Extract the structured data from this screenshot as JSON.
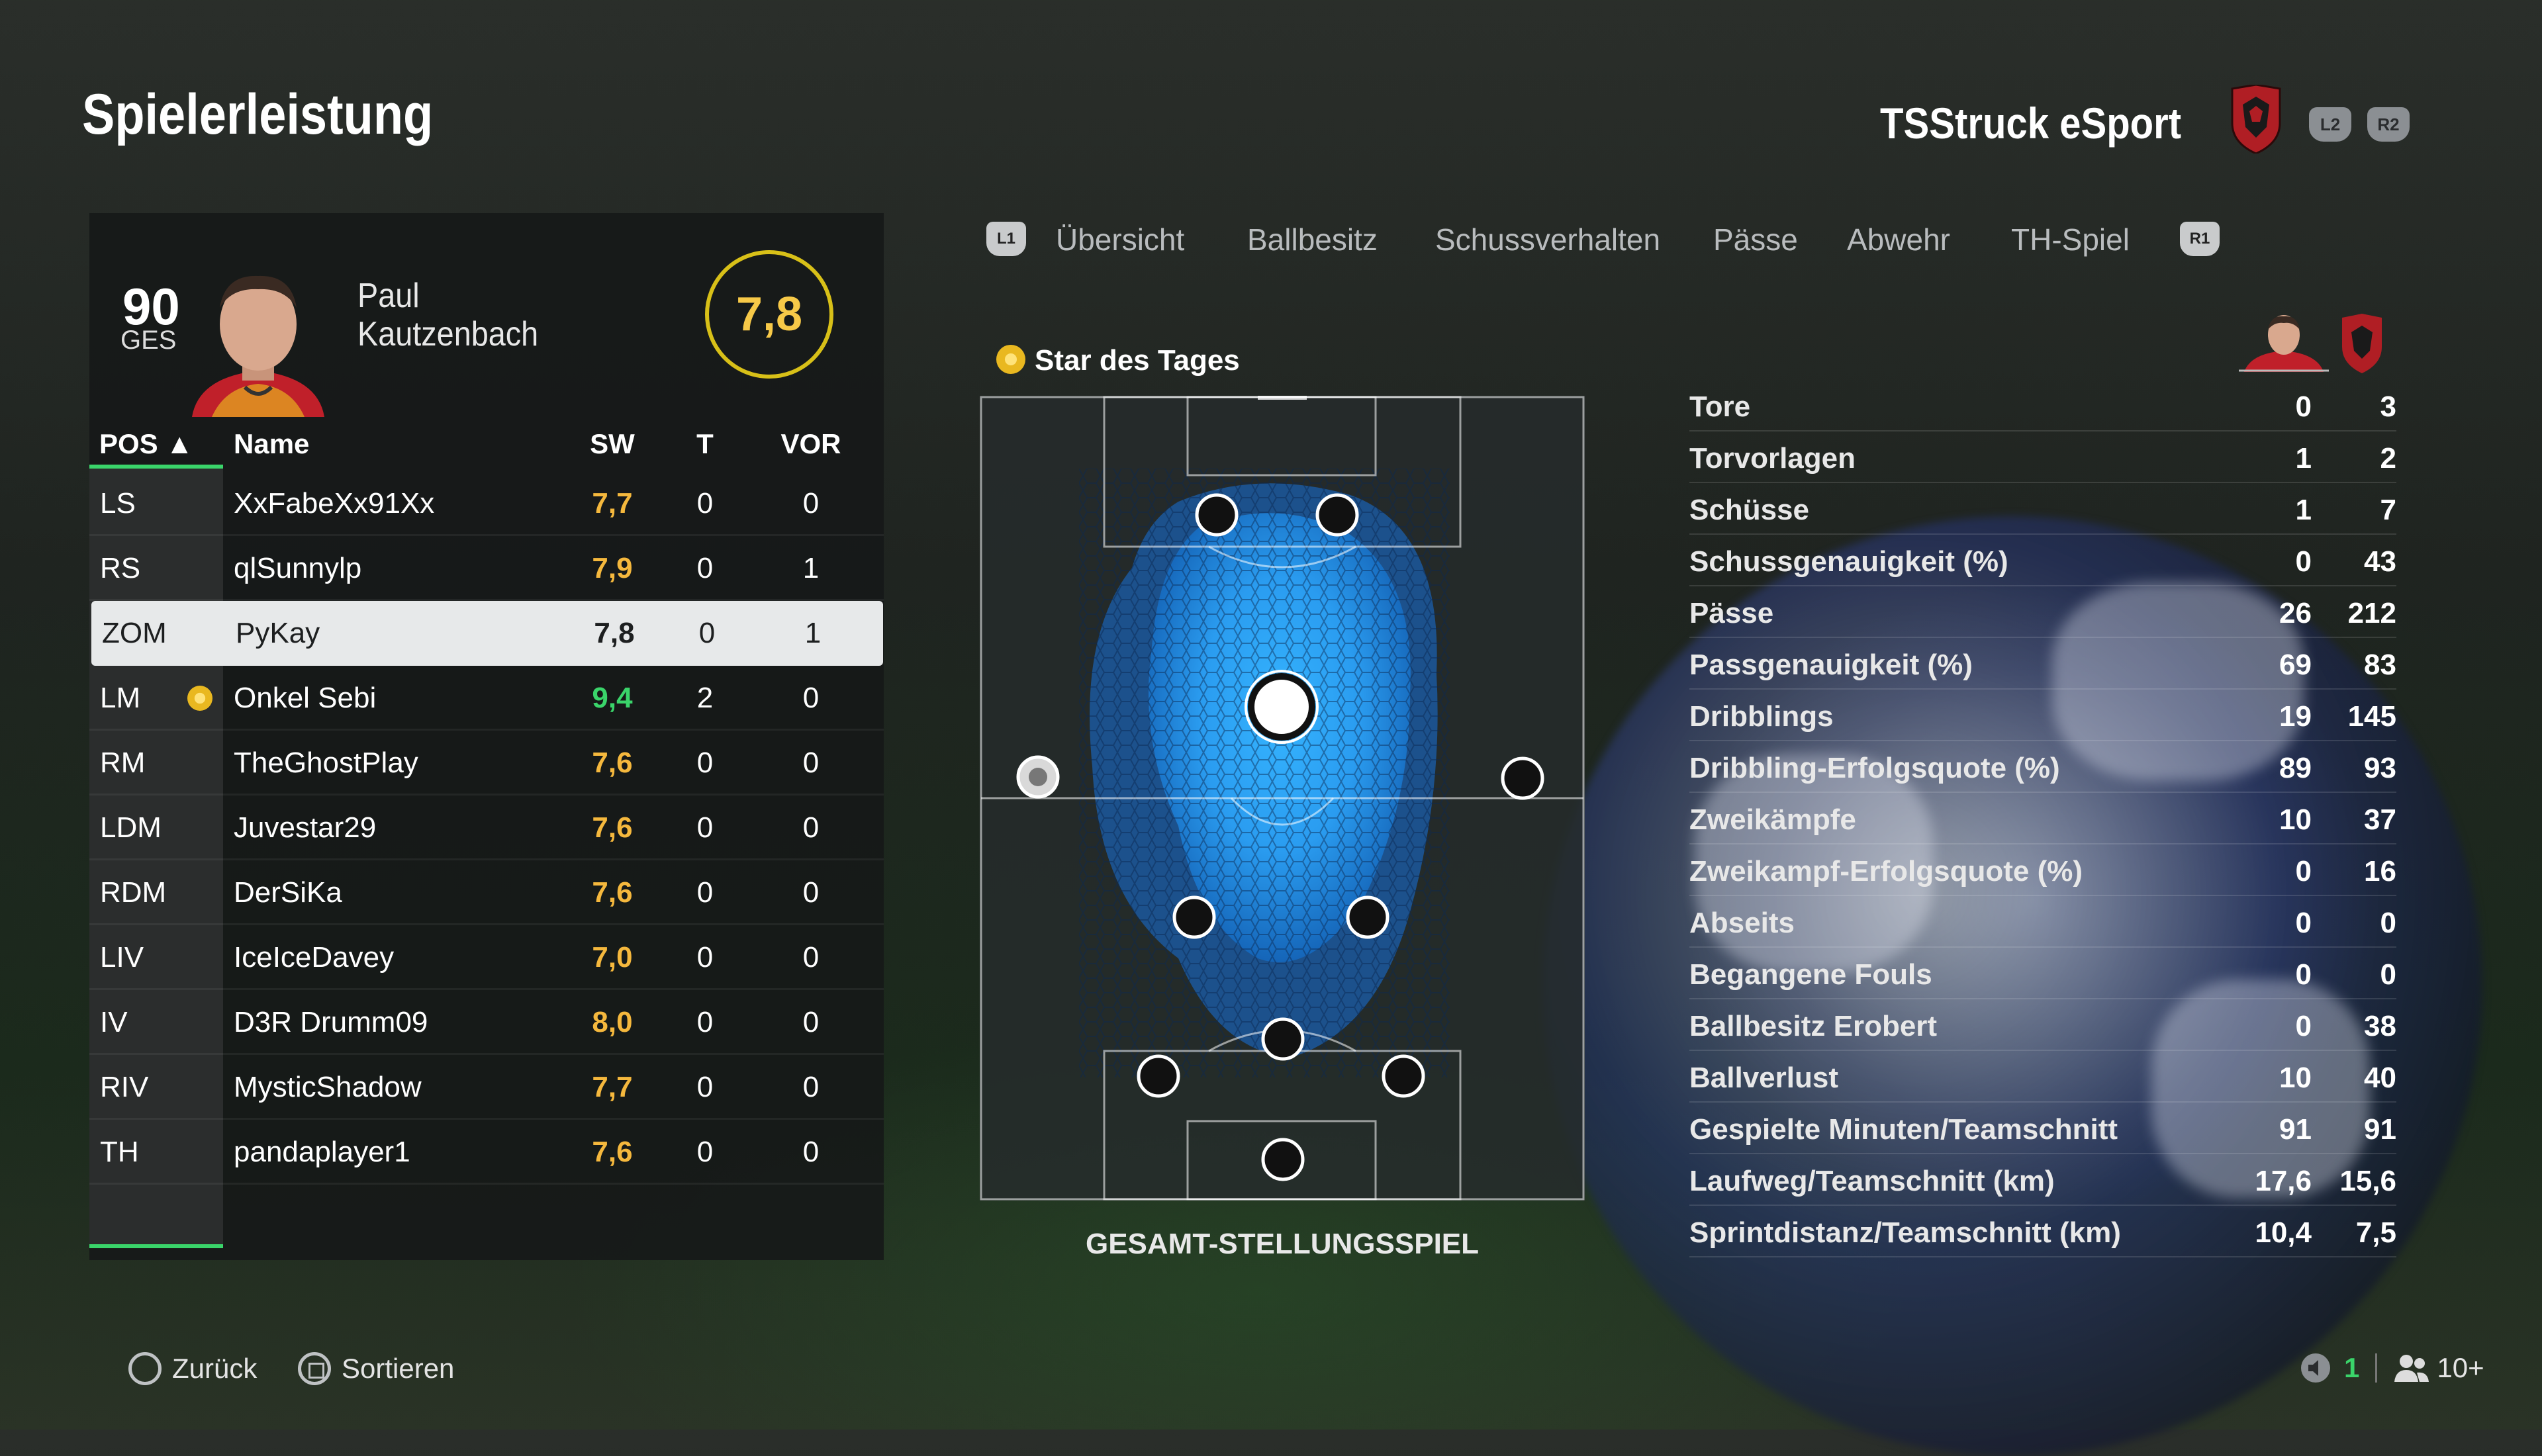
{
  "header": {
    "title": "Spielerleistung",
    "team": "TSStruck eSport",
    "l2": "L2",
    "r2": "R2"
  },
  "player": {
    "ovr": "90",
    "ovr_label": "GES",
    "first_name": "Paul",
    "last_name": "Kautzenbach",
    "rating": "7,8"
  },
  "table": {
    "headers": {
      "pos": "POS ▲",
      "name": "Name",
      "sw": "SW",
      "t": "T",
      "vor": "VOR"
    },
    "rows": [
      {
        "pos": "LS",
        "name": "XxFabeXx91Xx",
        "sw": "7,7",
        "t": "0",
        "vor": "0",
        "color": "#f5b83d"
      },
      {
        "pos": "RS",
        "name": "qlSunnylp",
        "sw": "7,9",
        "t": "0",
        "vor": "1",
        "color": "#f5b83d"
      },
      {
        "pos": "ZOM",
        "name": "PyKay",
        "sw": "7,8",
        "t": "0",
        "vor": "1",
        "color": "#1d1f20",
        "selected": true
      },
      {
        "pos": "LM",
        "name": "Onkel Sebi",
        "sw": "9,4",
        "t": "2",
        "vor": "0",
        "color": "#3ad46a",
        "star": true
      },
      {
        "pos": "RM",
        "name": "TheGhostPlay",
        "sw": "7,6",
        "t": "0",
        "vor": "0",
        "color": "#f5b83d"
      },
      {
        "pos": "LDM",
        "name": "Juvestar29",
        "sw": "7,6",
        "t": "0",
        "vor": "0",
        "color": "#f5b83d"
      },
      {
        "pos": "RDM",
        "name": "DerSiKa",
        "sw": "7,6",
        "t": "0",
        "vor": "0",
        "color": "#f5b83d"
      },
      {
        "pos": "LIV",
        "name": "IceIceDavey",
        "sw": "7,0",
        "t": "0",
        "vor": "0",
        "color": "#f5b83d"
      },
      {
        "pos": "IV",
        "name": "D3R Drumm09",
        "sw": "8,0",
        "t": "0",
        "vor": "0",
        "color": "#f5b83d"
      },
      {
        "pos": "RIV",
        "name": "MysticShadow",
        "sw": "7,7",
        "t": "0",
        "vor": "0",
        "color": "#f5b83d"
      },
      {
        "pos": "TH",
        "name": "pandaplayer1",
        "sw": "7,6",
        "t": "0",
        "vor": "0",
        "color": "#f5b83d"
      }
    ]
  },
  "tabs": {
    "l1": "L1",
    "r1": "R1",
    "items": [
      "Übersicht",
      "Ballbesitz",
      "Schussverhalten",
      "Pässe",
      "Abwehr",
      "TH-Spiel"
    ],
    "active": 0
  },
  "star_of_day": "Star des Tages",
  "pitch_label": "GESAMT-STELLUNGSSPIEL",
  "stats": [
    {
      "label": "Tore",
      "player": "0",
      "team": "3"
    },
    {
      "label": "Torvorlagen",
      "player": "1",
      "team": "2"
    },
    {
      "label": "Schüsse",
      "player": "1",
      "team": "7"
    },
    {
      "label": "Schussgenauigkeit (%)",
      "player": "0",
      "team": "43"
    },
    {
      "label": "Pässe",
      "player": "26",
      "team": "212"
    },
    {
      "label": "Passgenauigkeit (%)",
      "player": "69",
      "team": "83"
    },
    {
      "label": "Dribblings",
      "player": "19",
      "team": "145"
    },
    {
      "label": "Dribbling-Erfolgsquote (%)",
      "player": "89",
      "team": "93"
    },
    {
      "label": "Zweikämpfe",
      "player": "10",
      "team": "37"
    },
    {
      "label": "Zweikampf-Erfolgsquote (%)",
      "player": "0",
      "team": "16"
    },
    {
      "label": "Abseits",
      "player": "0",
      "team": "0"
    },
    {
      "label": "Begangene Fouls",
      "player": "0",
      "team": "0"
    },
    {
      "label": "Ballbesitz Erobert",
      "player": "0",
      "team": "38"
    },
    {
      "label": "Ballverlust",
      "player": "10",
      "team": "40"
    },
    {
      "label": "Gespielte Minuten/Teamschnitt",
      "player": "91",
      "team": "91"
    },
    {
      "label": "Laufweg/Teamschnitt (km)",
      "player": "17,6",
      "team": "15,6"
    },
    {
      "label": "Sprintdistanz/Teamschnitt (km)",
      "player": "10,4",
      "team": "7,5"
    }
  ],
  "footer": {
    "back": "Zurück",
    "sort": "Sortieren",
    "count": "1",
    "players": "10+"
  }
}
